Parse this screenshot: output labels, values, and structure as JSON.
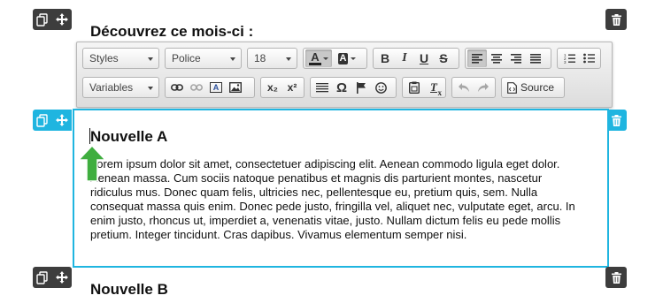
{
  "sections": {
    "first_title": "Découvrez ce mois-ci :",
    "active_title": "Nouvelle A",
    "active_body": "Lorem ipsum dolor sit amet, consectetuer adipiscing elit. Aenean commodo ligula eget dolor. Aenean massa. Cum sociis natoque penatibus et magnis dis parturient montes, nascetur ridiculus mus. Donec quam felis, ultricies nec, pellentesque eu, pretium quis, sem. Nulla consequat massa quis enim. Donec pede justo, fringilla vel, aliquet nec, vulputate eget, arcu. In enim justo, rhoncus ut, imperdiet a, venenatis vitae, justo. Nullam dictum felis eu pede mollis pretium. Integer tincidunt. Cras dapibus. Vivamus elementum semper nisi.",
    "next_title": "Nouvelle B"
  },
  "toolbar": {
    "styles_label": "Styles",
    "font_label": "Police",
    "size_label": "18",
    "variables_label": "Variables",
    "source_label": "Source",
    "bold_glyph": "B",
    "italic_glyph": "I",
    "underline_glyph": "U",
    "strike_glyph": "S",
    "special_char_glyph": "Ω",
    "text_color_glyph": "A",
    "bg_color_glyph": "A",
    "image_text_glyph": "A",
    "subscript_glyph": "x₂",
    "superscript_glyph": "x²",
    "remove_format_glyph": "T"
  },
  "colors": {
    "accent": "#1fb5e0",
    "control_dark": "#3d3d3d",
    "arrow": "#3fae3f"
  }
}
